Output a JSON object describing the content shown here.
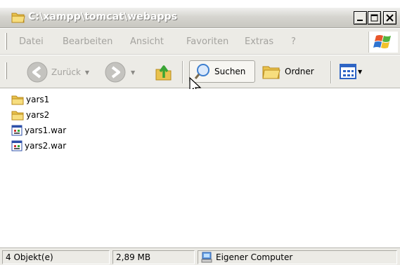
{
  "window": {
    "title": "C:\\xampp\\tomcat\\webapps"
  },
  "menu": {
    "items": [
      "Datei",
      "Bearbeiten",
      "Ansicht",
      "Favoriten",
      "Extras",
      "?"
    ]
  },
  "toolbar": {
    "back_label": "Zurück",
    "search_label": "Suchen",
    "folders_label": "Ordner"
  },
  "files": [
    {
      "name": "yars1",
      "icon": "folder-icon"
    },
    {
      "name": "yars2",
      "icon": "folder-icon"
    },
    {
      "name": "yars1.war",
      "icon": "war-file-icon"
    },
    {
      "name": "yars2.war",
      "icon": "war-file-icon"
    }
  ],
  "status": {
    "objects": "4 Objekt(e)",
    "size": "2,89 MB",
    "location": "Eigener Computer"
  },
  "colors": {
    "folder": "#f5d46a",
    "nav_arrow": "#8fc1f0",
    "title_text": "#ffffff"
  }
}
